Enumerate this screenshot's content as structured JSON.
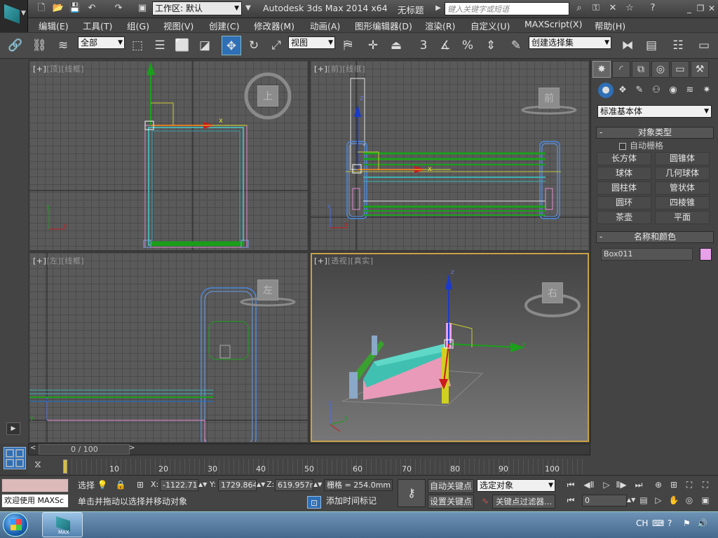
{
  "titlebar": {
    "workspace": "工作区: 默认",
    "app_title": "Autodesk 3ds Max  2014 x64",
    "doc_title": "无标题",
    "search_placeholder": "键入关键字或短语"
  },
  "menu": [
    "编辑(E)",
    "工具(T)",
    "组(G)",
    "视图(V)",
    "创建(C)",
    "修改器(M)",
    "动画(A)",
    "图形编辑器(D)",
    "渲染(R)",
    "自定义(U)",
    "MAXScript(X)",
    "帮助(H)"
  ],
  "toolbar": {
    "filter": "全部",
    "coord_system": "视图",
    "snap_label": "3",
    "selection_set": "创建选择集"
  },
  "viewports": {
    "top": {
      "plus": "[+]",
      "name": "[顶]",
      "mode": "[线框]",
      "cube_label": "上"
    },
    "front": {
      "plus": "[+]",
      "name": "[前]",
      "mode": "[线框]",
      "cube_label": "前"
    },
    "left": {
      "plus": "[+]",
      "name": "[左]",
      "mode": "[线框]",
      "cube_label": "左"
    },
    "persp": {
      "plus": "[+]",
      "name": "[透视]",
      "mode": "[真实]",
      "cube_label": "右"
    },
    "axis_x": "x",
    "axis_y": "y",
    "axis_z": "z"
  },
  "command_panel": {
    "primitive_type": "标准基本体",
    "object_type_title": "对象类型",
    "auto_grid": "自动栅格",
    "buttons": [
      "长方体",
      "圆锥体",
      "球体",
      "几何球体",
      "圆柱体",
      "管状体",
      "圆环",
      "四棱锥",
      "茶壶",
      "平面"
    ],
    "name_color_title": "名称和颜色",
    "object_name": "Box011",
    "object_color": "#e8a0e8"
  },
  "timeline": {
    "frame_display": "0 / 100",
    "ticks": [
      "10",
      "20",
      "30",
      "40",
      "50",
      "60",
      "70",
      "80",
      "90",
      "100"
    ]
  },
  "status": {
    "maxscript_prompt": "欢迎使用 MAXSc",
    "select_label": "选择",
    "x_label": "X:",
    "x_value": "-1122.713",
    "y_label": "Y:",
    "y_value": "1729.864m",
    "z_label": "Z:",
    "z_value": "619.957mr",
    "grid": "栅格 = 254.0mm",
    "prompt_text": "单击并拖动以选择并移动对象",
    "add_time_tag": "添加时间标记",
    "auto_key": "自动关键点",
    "set_key": "设置关键点",
    "key_mode": "选定对象",
    "key_filters": "关键点过滤器...",
    "current_frame": "0"
  },
  "taskbar": {
    "max_label": "MAX",
    "lang": "CH"
  }
}
